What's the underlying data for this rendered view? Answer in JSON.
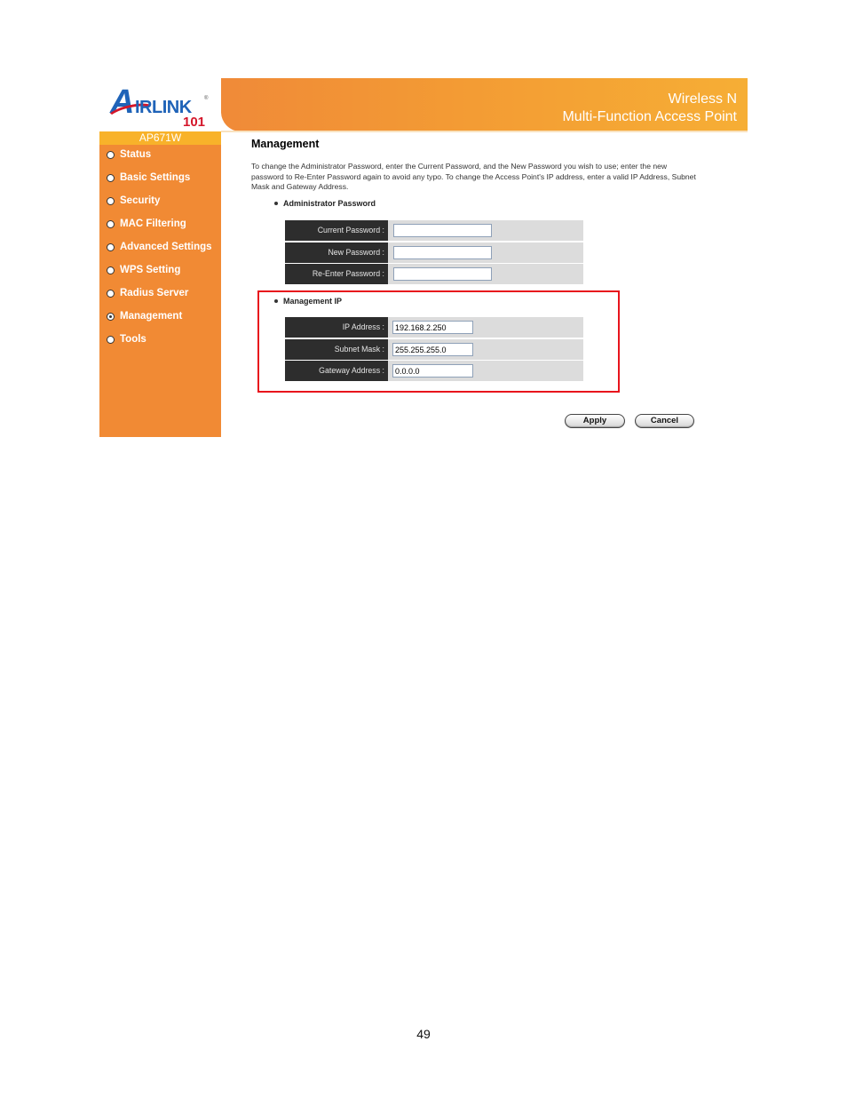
{
  "logo": {
    "brand_a": "A",
    "brand_rest": "IRLINK",
    "registered": "®",
    "brand_number": "101"
  },
  "header": {
    "line1": "Wireless N",
    "line2": "Multi-Function Access Point"
  },
  "sidebar": {
    "model": "AP671W",
    "items": [
      {
        "label": "Status",
        "selected": false
      },
      {
        "label": "Basic Settings",
        "selected": false
      },
      {
        "label": "Security",
        "selected": false
      },
      {
        "label": "MAC Filtering",
        "selected": false
      },
      {
        "label": "Advanced Settings",
        "selected": false
      },
      {
        "label": "WPS Setting",
        "selected": false
      },
      {
        "label": "Radius Server",
        "selected": false
      },
      {
        "label": "Management",
        "selected": true
      },
      {
        "label": "Tools",
        "selected": false
      }
    ]
  },
  "main": {
    "title": "Management",
    "intro": "To change the Administrator Password, enter the Current Password, and the New Password you wish to use; enter the new password to Re-Enter Password again to avoid any typo. To change the Access Point's IP address, enter a valid IP Address, Subnet Mask and Gateway Address.",
    "admin_section": {
      "label": "Administrator Password",
      "fields": [
        {
          "label": "Current Password :",
          "value": ""
        },
        {
          "label": "New Password :",
          "value": ""
        },
        {
          "label": "Re-Enter Password :",
          "value": ""
        }
      ]
    },
    "ip_section": {
      "label": "Management IP",
      "fields": [
        {
          "label": "IP Address :",
          "value": "192.168.2.250"
        },
        {
          "label": "Subnet Mask :",
          "value": "255.255.255.0"
        },
        {
          "label": "Gateway Address :",
          "value": "0.0.0.0"
        }
      ]
    },
    "buttons": {
      "apply": "Apply",
      "cancel": "Cancel"
    },
    "highlight_color": "#e8141c"
  },
  "colors": {
    "sidebar": "#f18a34",
    "model_bar": "#f8b22a",
    "label_bg": "#2d2d2d",
    "row_bg": "#dcdcdc"
  },
  "page_number": "49"
}
